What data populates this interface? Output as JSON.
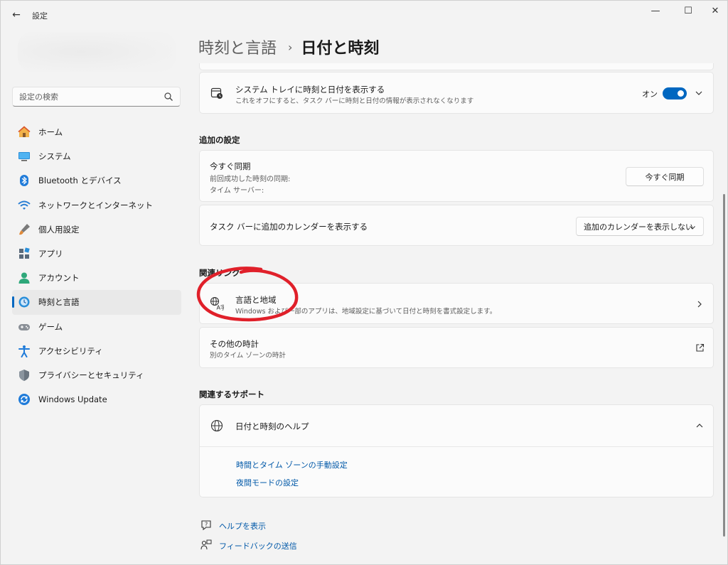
{
  "window": {
    "title": "設定",
    "minimize": "—",
    "maximize": "☐",
    "close": "✕",
    "back": "←"
  },
  "sidebar": {
    "search_placeholder": "設定の検索",
    "items": [
      {
        "label": "ホーム",
        "icon": "home-icon"
      },
      {
        "label": "システム",
        "icon": "system-icon"
      },
      {
        "label": "Bluetooth とデバイス",
        "icon": "bluetooth-icon"
      },
      {
        "label": "ネットワークとインターネット",
        "icon": "wifi-icon"
      },
      {
        "label": "個人用設定",
        "icon": "brush-icon"
      },
      {
        "label": "アプリ",
        "icon": "apps-icon"
      },
      {
        "label": "アカウント",
        "icon": "account-icon"
      },
      {
        "label": "時刻と言語",
        "icon": "time-language-icon",
        "active": true
      },
      {
        "label": "ゲーム",
        "icon": "gamepad-icon"
      },
      {
        "label": "アクセシビリティ",
        "icon": "accessibility-icon"
      },
      {
        "label": "プライバシーとセキュリティ",
        "icon": "shield-icon"
      },
      {
        "label": "Windows Update",
        "icon": "update-icon"
      }
    ]
  },
  "breadcrumb": {
    "parent": "時刻と言語",
    "separator": "›",
    "current": "日付と時刻"
  },
  "systray": {
    "title": "システム トレイに時刻と日付を表示する",
    "subtitle": "これをオフにすると、タスク バーに時刻と日付の情報が表示されなくなります",
    "toggle_label": "オン",
    "toggle_on": true
  },
  "additional": {
    "heading": "追加の設定",
    "sync": {
      "title": "今すぐ同期",
      "last_sync": "前回成功した時刻の同期:",
      "time_server": "タイム サーバー:",
      "button": "今すぐ同期"
    },
    "calendar": {
      "title": "タスク バーに追加のカレンダーを表示する",
      "selected": "追加のカレンダーを表示しない"
    }
  },
  "related_links": {
    "heading": "関連リンク",
    "region": {
      "title": "言語と地域",
      "subtitle": "Windows および一部のアプリは、地域設定に基づいて日付と時刻を書式設定します。"
    },
    "clocks": {
      "title": "その他の時計",
      "subtitle": "別のタイム ゾーンの時計"
    }
  },
  "support": {
    "heading": "関連するサポート",
    "help_title": "日付と時刻のヘルプ",
    "links": [
      "時間とタイム ゾーンの手動設定",
      "夜間モードの設定"
    ]
  },
  "footer": {
    "help": "ヘルプを表示",
    "feedback": "フィードバックの送信"
  },
  "colors": {
    "accent": "#0067c0",
    "link": "#0058a8",
    "annotation": "#e0202a"
  }
}
